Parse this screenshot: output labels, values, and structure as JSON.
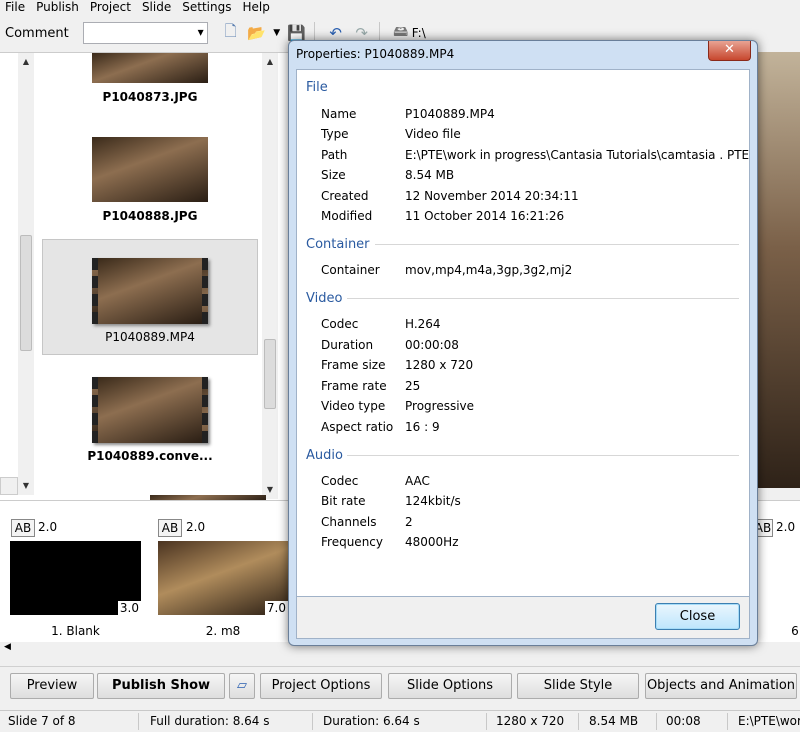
{
  "menu": [
    "File",
    "Publish",
    "Project",
    "Slide",
    "Settings",
    "Help"
  ],
  "toolbar": {
    "comment_label": "Comment",
    "comment_value": "",
    "drive_label": "F:\\"
  },
  "files": [
    {
      "name": "P1040873.JPG"
    },
    {
      "name": "P1040888.JPG"
    },
    {
      "name": "P1040889.MP4"
    },
    {
      "name": "P1040889.conve..."
    }
  ],
  "slides": [
    {
      "ab": "AB",
      "ab_value": "2.0",
      "duration": "3.0",
      "label": "1. Blank"
    },
    {
      "ab": "AB",
      "ab_value": "2.0",
      "duration": "7.0",
      "label": "2. m8"
    },
    {
      "ab": "AB",
      "ab_value": "2.0",
      "label": "6"
    }
  ],
  "buttons": {
    "preview": "Preview",
    "publish_show": "Publish Show",
    "project_options": "Project Options",
    "slide_options": "Slide Options",
    "slide_style": "Slide Style",
    "objects_animation": "Objects and Animation"
  },
  "status": {
    "slide": "Slide 7 of 8",
    "full_duration": "Full duration: 8.64 s",
    "duration": "Duration: 6.64 s",
    "resolution": "1280 x 720",
    "size": "8.54 MB",
    "time": "00:08",
    "path": "E:\\PTE\\wor"
  },
  "dialog": {
    "title": "Properties: P1040889.MP4",
    "close_x": "✕",
    "close_button": "Close",
    "sections": {
      "file": {
        "heading": "File",
        "rows": [
          {
            "k": "Name",
            "v": "P1040889.MP4"
          },
          {
            "k": "Type",
            "v": "Video file"
          },
          {
            "k": "Path",
            "v": "E:\\PTE\\work in progress\\Cantasia Tutorials\\camtasia . PTE TUTS"
          },
          {
            "k": "Size",
            "v": "8.54 MB"
          },
          {
            "k": "Created",
            "v": "12 November 2014  20:34:11"
          },
          {
            "k": "Modified",
            "v": "11 October 2014  16:21:26"
          }
        ]
      },
      "container": {
        "heading": "Container",
        "rows": [
          {
            "k": "Container",
            "v": "mov,mp4,m4a,3gp,3g2,mj2"
          }
        ]
      },
      "video": {
        "heading": "Video",
        "rows": [
          {
            "k": "Codec",
            "v": "H.264"
          },
          {
            "k": "Duration",
            "v": "00:00:08"
          },
          {
            "k": "Frame size",
            "v": "1280 x 720"
          },
          {
            "k": "Frame rate",
            "v": "25"
          },
          {
            "k": "Video type",
            "v": "Progressive"
          },
          {
            "k": "Aspect ratio",
            "v": "16 : 9"
          }
        ]
      },
      "audio": {
        "heading": "Audio",
        "rows": [
          {
            "k": "Codec",
            "v": "AAC"
          },
          {
            "k": "Bit rate",
            "v": "124kbit/s"
          },
          {
            "k": "Channels",
            "v": "2"
          },
          {
            "k": "Frequency",
            "v": "48000Hz"
          }
        ]
      }
    }
  }
}
